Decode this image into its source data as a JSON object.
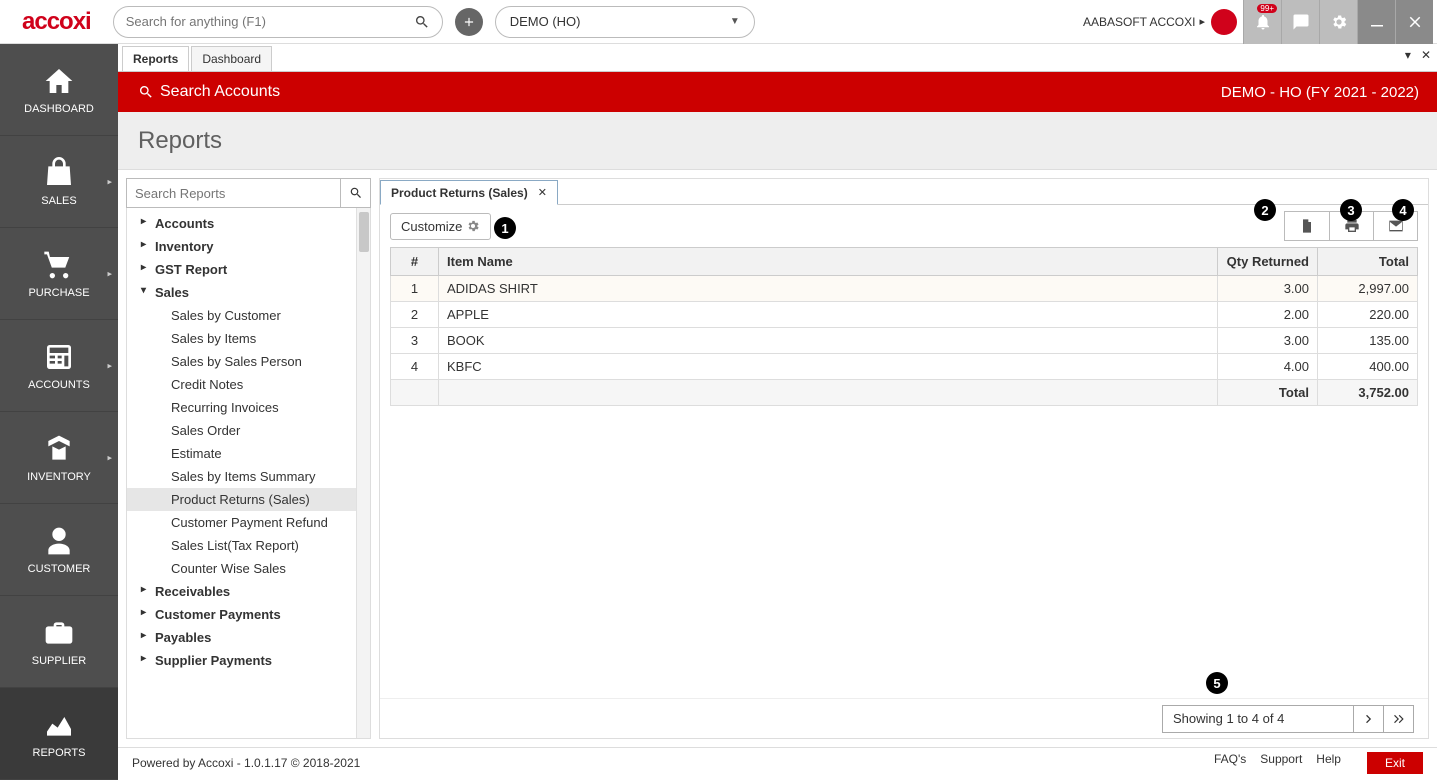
{
  "header": {
    "logo": "accoxi",
    "search_placeholder": "Search for anything (F1)",
    "demo_label": "DEMO (HO)",
    "user_name": "AABASOFT ACCOXI",
    "notif_badge": "99+"
  },
  "leftnav": [
    {
      "label": "DASHBOARD",
      "icon": "home"
    },
    {
      "label": "SALES",
      "icon": "bag",
      "expand": true
    },
    {
      "label": "PURCHASE",
      "icon": "cart",
      "expand": true
    },
    {
      "label": "ACCOUNTS",
      "icon": "calculator",
      "expand": true
    },
    {
      "label": "INVENTORY",
      "icon": "inventory",
      "expand": true
    },
    {
      "label": "CUSTOMER",
      "icon": "person"
    },
    {
      "label": "SUPPLIER",
      "icon": "briefcase"
    },
    {
      "label": "REPORTS",
      "icon": "chart"
    }
  ],
  "main_tabs": {
    "reports": "Reports",
    "dashboard": "Dashboard"
  },
  "red_header": {
    "search_label": "Search Accounts",
    "right_label": "DEMO - HO (FY 2021 - 2022)"
  },
  "page_title": "Reports",
  "report_search_placeholder": "Search Reports",
  "tree": {
    "accounts": "Accounts",
    "inventory": "Inventory",
    "gst": "GST Report",
    "sales": "Sales",
    "sales_children": [
      "Sales by Customer",
      "Sales by Items",
      "Sales by Sales Person",
      "Credit Notes",
      "Recurring Invoices",
      "Sales Order",
      "Estimate",
      "Sales by Items Summary",
      "Product Returns (Sales)",
      "Customer Payment Refund",
      "Sales List(Tax Report)",
      "Counter Wise Sales"
    ],
    "receivables": "Receivables",
    "customer_payments": "Customer Payments",
    "payables": "Payables",
    "supplier_payments": "Supplier Payments"
  },
  "report_tab": "Product Returns (Sales)",
  "customize_label": "Customize",
  "table": {
    "headers": {
      "no": "#",
      "name": "Item Name",
      "qty": "Qty Returned",
      "total": "Total"
    },
    "rows": [
      {
        "no": "1",
        "name": "ADIDAS SHIRT",
        "qty": "3.00",
        "total": "2,997.00"
      },
      {
        "no": "2",
        "name": "APPLE",
        "qty": "2.00",
        "total": "220.00"
      },
      {
        "no": "3",
        "name": "BOOK",
        "qty": "3.00",
        "total": "135.00"
      },
      {
        "no": "4",
        "name": "KBFC",
        "qty": "4.00",
        "total": "400.00"
      }
    ],
    "total_label": "Total",
    "total_value": "3,752.00"
  },
  "pager_text": "Showing 1 to 4 of 4",
  "footer": {
    "left": "Powered by Accoxi - 1.0.1.17 © 2018-2021",
    "faqs": "FAQ's",
    "support": "Support",
    "help": "Help",
    "exit": "Exit"
  },
  "callouts": {
    "c1": "1",
    "c2": "2",
    "c3": "3",
    "c4": "4",
    "c5": "5"
  }
}
